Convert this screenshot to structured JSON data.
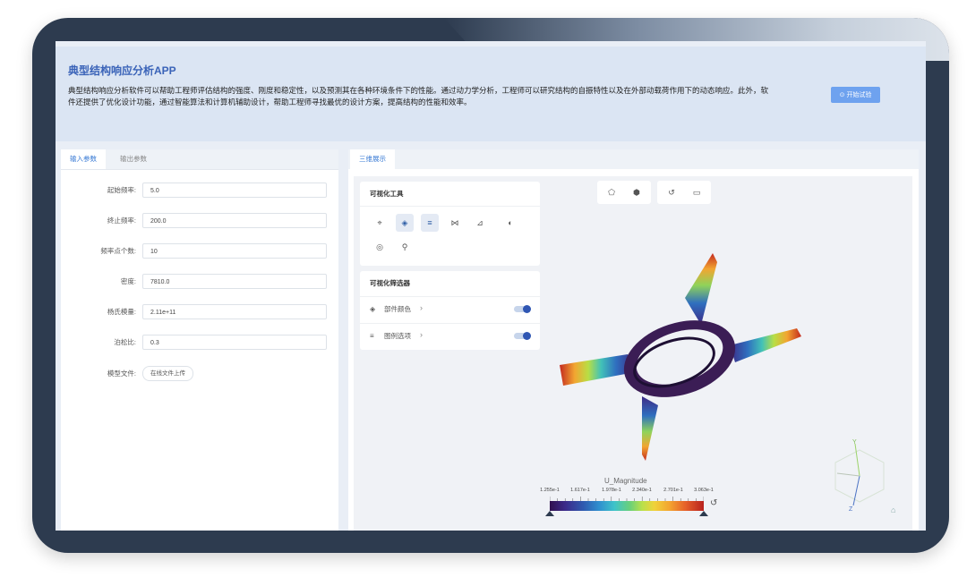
{
  "app": {
    "title": "典型结构响应分析APP",
    "description": "典型结构响应分析软件可以帮助工程师评估结构的强度、刚度和稳定性，以及预测其在各种环境条件下的性能。通过动力学分析，工程师可以研究结构的自振特性以及在外部动载荷作用下的动态响应。此外，软件还提供了优化设计功能，通过智能算法和计算机辅助设计，帮助工程师寻找最优的设计方案，提高结构的性能和效率。",
    "start_button": "开始试验"
  },
  "left_panel": {
    "tabs": [
      {
        "label": "输入参数",
        "active": true
      },
      {
        "label": "输出参数",
        "active": false
      }
    ],
    "fields": [
      {
        "label": "起始频率:",
        "value": "5.0"
      },
      {
        "label": "终止频率:",
        "value": "200.0"
      },
      {
        "label": "频率点个数:",
        "value": "10"
      },
      {
        "label": "密度:",
        "value": "7810.0"
      },
      {
        "label": "杨氏模量:",
        "value": "2.11e+11"
      },
      {
        "label": "泊松比:",
        "value": "0.3"
      }
    ],
    "model_file_label": "模型文件:",
    "upload_button": "在线文件上传"
  },
  "right_panel": {
    "tab": "三维展示",
    "tools_card_title": "可视化工具",
    "filter_card_title": "可视化筛选器",
    "filters": [
      {
        "label": "部件颜色",
        "icon": "paint-bucket-icon",
        "enabled": true
      },
      {
        "label": "图例选项",
        "icon": "legend-icon",
        "enabled": true
      }
    ],
    "legend": {
      "title": "U_Magnitude",
      "ticks": [
        "1.255e-1",
        "1.617e-1",
        "1.978e-1",
        "2.340e-1",
        "2.701e-1",
        "3.063e-1"
      ]
    },
    "axes": {
      "y": "Y",
      "z": "Z"
    }
  },
  "colors": {
    "accent": "#3a7bd5",
    "title": "#3a63b8",
    "device_frame": "#2d3b4f",
    "toggle_on": "#2f56b3"
  }
}
